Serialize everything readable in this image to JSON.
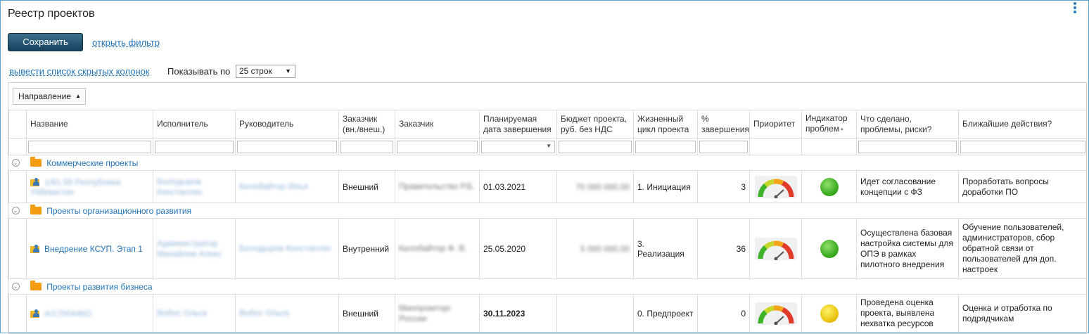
{
  "page": {
    "title": "Реестр проектов",
    "save_label": "Сохранить",
    "open_filter_label": "открыть фильтр",
    "hidden_columns_label": "вывести список скрытых колонок",
    "show_per_label": "Показывать по",
    "rows_per_page": "25 строк"
  },
  "grid": {
    "group_by_label": "Направление",
    "columns": [
      "Название",
      "Исполнитель",
      "Руководитель",
      "Заказчик (вн./внеш.)",
      "Заказчик",
      "Планируемая дата завершения",
      "Бюджет проекта, руб. без НДС",
      "Жизненный цикл проекта",
      "% завершения",
      "Приоритет",
      "Индикатор проблем",
      "Что сделано, проблемы, риски?",
      "Ближайшие действия?"
    ],
    "groups": [
      {
        "title": "Коммерческие проекты",
        "row": {
          "name": "1/61.58 Республика Узбекистан",
          "executor": "Болодыров Константин",
          "manager": "Килобайтор Илья",
          "customer_type": "Внешний",
          "customer": "Правительство Р.Б.",
          "end_date": "01.03.2021",
          "budget": "70 000 000,00",
          "lifecycle": "1. Инициация",
          "percent": "3",
          "indicator": "green",
          "done": "Идет согласование концепции с ФЗ",
          "next": "Проработать вопросы доработки ПО"
        }
      },
      {
        "title": "Проекты организационного развития",
        "row": {
          "name": "Внедрение КСУП. Этап 1",
          "executor": "Администратор Михайлов Алекс",
          "manager": "Болодыров Константин",
          "customer_type": "Внутренний",
          "customer": "Килобайтор Ф. В.",
          "end_date": "25.05.2020",
          "budget": "5 000 000,00",
          "lifecycle": "3. Реализация",
          "percent": "36",
          "indicator": "green",
          "done": "Осуществлена базовая настройка системы для ОПЭ в рамках пилотного внедрения",
          "next": "Обучение пользователей, администраторов, сбор обратной связи от пользователей для доп. настроек"
        }
      },
      {
        "title": "Проекты развития бизнеса",
        "row": {
          "name": "А/170044КО",
          "executor": "Вобос Ольга",
          "manager": "Вобос Ольга",
          "customer_type": "Внешний",
          "customer": "Минпромторг России",
          "end_date": "30.11.2023",
          "budget": "",
          "lifecycle": "0. Предпроект",
          "percent": "0",
          "indicator": "yellow",
          "done": "Проведена оценка проекта, выявлена нехватка ресурсов",
          "next": "Оценка и отработка по подрядчикам"
        }
      }
    ]
  },
  "icons": {
    "gauge": "priority-gauge-icon",
    "folder": "folder-icon",
    "project": "project-icon",
    "expand": "expand-icon",
    "menu": "kebab-menu-icon"
  },
  "colors": {
    "link": "#2474b8",
    "save_button": "#1e4d6b",
    "indicator_green": "#37a81c",
    "indicator_yellow": "#e8c10d",
    "folder": "#f39c12"
  }
}
